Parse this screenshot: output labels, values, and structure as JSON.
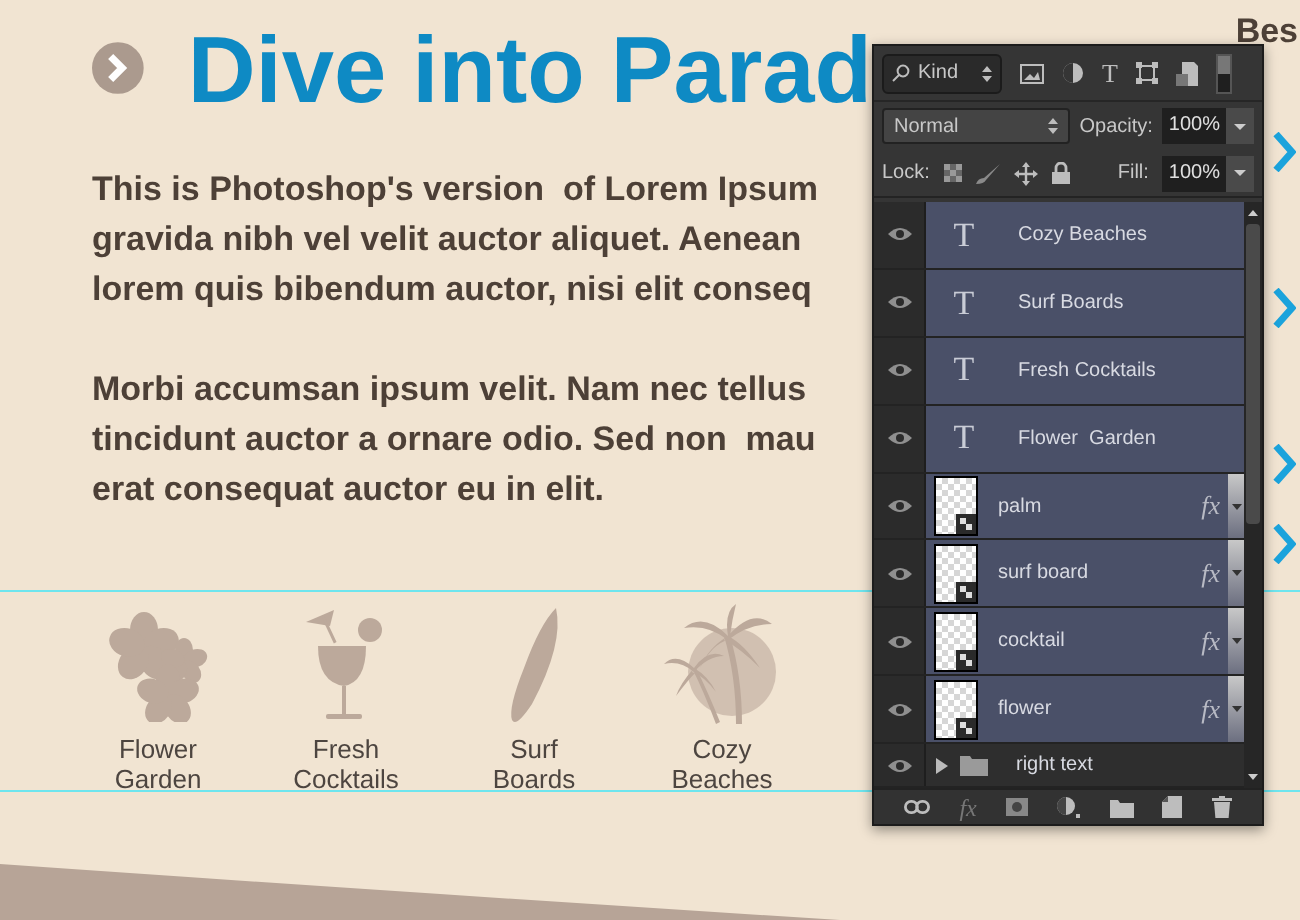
{
  "heading": "Dive into Parad",
  "paragraphs": [
    {
      "lines": [
        "This is Photoshop's version  of Lorem Ipsum",
        "gravida nibh vel velit auctor aliquet. Aenean",
        "lorem quis bibendum auctor, nisi elit conseq"
      ]
    },
    {
      "lines": [
        "Morbi accumsan ipsum velit. Nam nec tellus",
        "tincidunt auctor a ornare odio. Sed non  mau",
        "erat consequat auctor eu in elit."
      ]
    }
  ],
  "features": [
    {
      "kind": "flower",
      "lines": [
        "Flower",
        "Garden"
      ]
    },
    {
      "kind": "cocktail",
      "lines": [
        "Fresh",
        "Cocktails"
      ]
    },
    {
      "kind": "surfboard",
      "lines": [
        "Surf",
        "Boards"
      ]
    },
    {
      "kind": "palm",
      "lines": [
        "Cozy",
        "Beaches"
      ]
    }
  ],
  "side_heading": "Bes",
  "layers_panel": {
    "filter": "Kind",
    "blend_mode": "Normal",
    "opacity_label": "Opacity:",
    "opacity": "100%",
    "lock_label": "Lock:",
    "fill_label": "Fill:",
    "fill": "100%",
    "type_filter": "T",
    "layers": [
      {
        "kind": "text",
        "type_icon": "T",
        "name": "Cozy Beaches",
        "selected": true
      },
      {
        "kind": "text",
        "type_icon": "T",
        "name": "Surf Boards",
        "selected": true
      },
      {
        "kind": "text",
        "type_icon": "T",
        "name": "Fresh Cocktails",
        "selected": true
      },
      {
        "kind": "text",
        "type_icon": "T",
        "name": "Flower  Garden",
        "selected": true
      },
      {
        "kind": "image",
        "name": "palm",
        "effects": "fx",
        "selected": true
      },
      {
        "kind": "image",
        "name": "surf board",
        "effects": "fx",
        "selected": true
      },
      {
        "kind": "image",
        "name": "cocktail",
        "effects": "fx",
        "selected": true
      },
      {
        "kind": "image",
        "name": "flower",
        "effects": "fx",
        "selected": true
      },
      {
        "kind": "group",
        "name": "right text",
        "selected": false
      }
    ],
    "footer_effects": "fx"
  }
}
